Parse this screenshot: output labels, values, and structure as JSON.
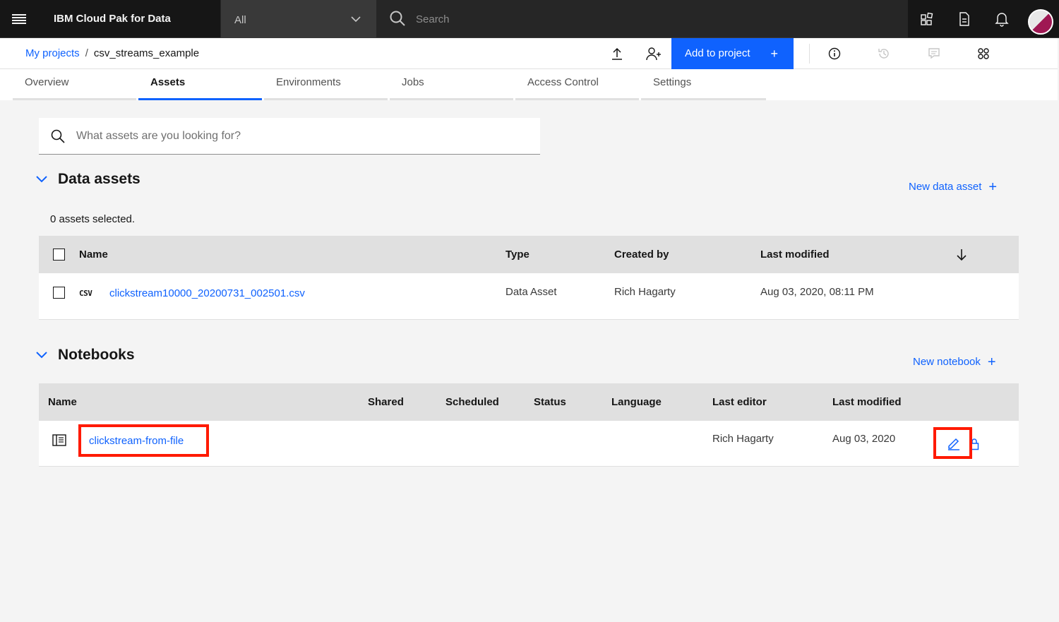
{
  "topbar": {
    "brand": "IBM Cloud Pak for Data",
    "scope": "All",
    "search_placeholder": "Search"
  },
  "breadcrumb": {
    "parent": "My projects",
    "separator": "/",
    "current": "csv_streams_example"
  },
  "header": {
    "add_to_project": "Add to project",
    "plus": "+"
  },
  "tabs": [
    {
      "label": "Overview"
    },
    {
      "label": "Assets"
    },
    {
      "label": "Environments"
    },
    {
      "label": "Jobs"
    },
    {
      "label": "Access Control"
    },
    {
      "label": "Settings"
    }
  ],
  "asset_search": {
    "placeholder": "What assets are you looking for?"
  },
  "data_assets": {
    "title": "Data assets",
    "new_link": "New data asset",
    "plus": "+",
    "selected_text": "0 assets selected.",
    "columns": {
      "name": "Name",
      "type": "Type",
      "created_by": "Created by",
      "last_modified": "Last modified"
    },
    "rows": [
      {
        "icon_label": "CSV",
        "name": "clickstream10000_20200731_002501.csv",
        "type": "Data Asset",
        "created_by": "Rich Hagarty",
        "last_modified": "Aug 03, 2020, 08:11 PM"
      }
    ]
  },
  "notebooks": {
    "title": "Notebooks",
    "new_link": "New notebook",
    "plus": "+",
    "columns": {
      "name": "Name",
      "shared": "Shared",
      "scheduled": "Scheduled",
      "status": "Status",
      "language": "Language",
      "last_editor": "Last editor",
      "last_modified": "Last modified"
    },
    "rows": [
      {
        "name": "clickstream-from-file",
        "last_editor": "Rich Hagarty",
        "last_modified": "Aug 03, 2020"
      }
    ]
  },
  "colors": {
    "accent": "#0f62fe",
    "highlight": "#ff1a00",
    "topbar": "#161616"
  }
}
